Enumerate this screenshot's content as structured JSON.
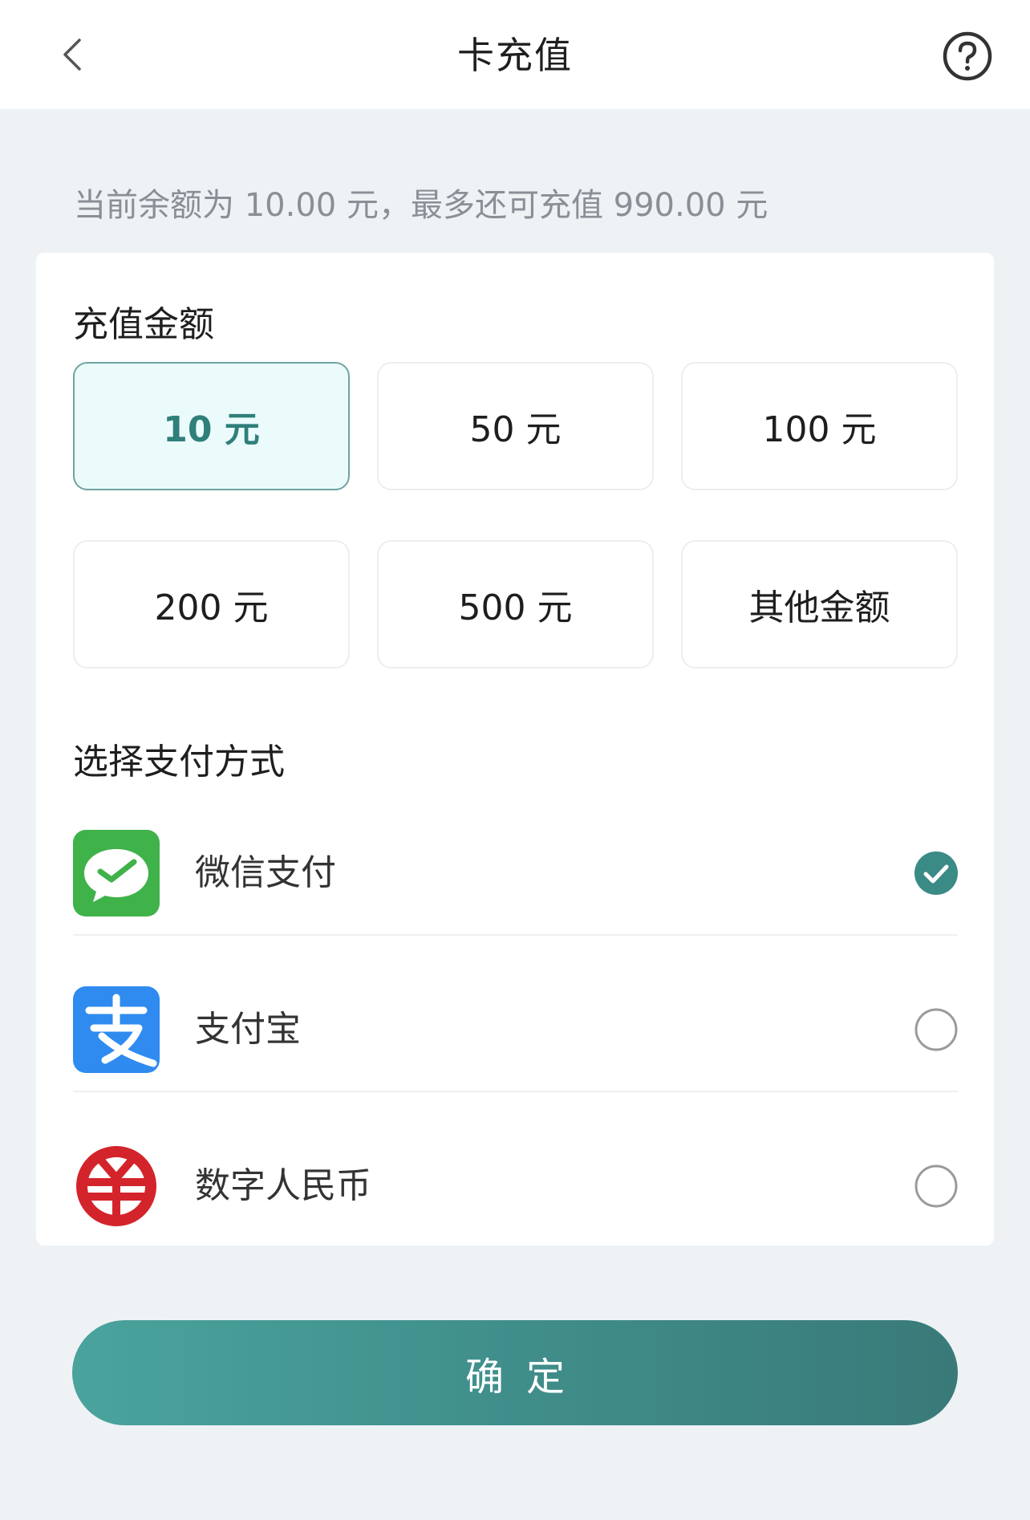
{
  "header": {
    "title": "卡充值",
    "back_icon": "chevron-left-icon",
    "help_icon": "help-circle-icon"
  },
  "balance_info": "当前余额为 10.00 元，最多还可充值 990.00 元",
  "amount_section": {
    "title": "充值金额",
    "options": [
      {
        "label": "10 元",
        "selected": true
      },
      {
        "label": "50 元",
        "selected": false
      },
      {
        "label": "100 元",
        "selected": false
      },
      {
        "label": "200 元",
        "selected": false
      },
      {
        "label": "500 元",
        "selected": false
      },
      {
        "label": "其他金额",
        "selected": false
      }
    ]
  },
  "payment_section": {
    "title": "选择支付方式",
    "methods": [
      {
        "label": "微信支付",
        "icon": "wechat-pay-icon",
        "selected": true
      },
      {
        "label": "支付宝",
        "icon": "alipay-icon",
        "selected": false
      },
      {
        "label": "数字人民币",
        "icon": "digital-rmb-icon",
        "selected": false
      }
    ]
  },
  "confirm_button": {
    "label": "确定"
  },
  "colors": {
    "accent": "#3f8c89",
    "selected_bg": "#ebfbfb",
    "wechat_green": "#3fb24a",
    "alipay_blue": "#2f8bf0",
    "ecny_red": "#d4242b",
    "page_bg": "#eef2f5"
  }
}
